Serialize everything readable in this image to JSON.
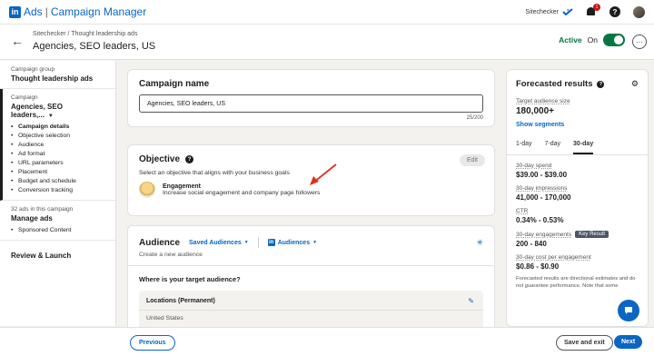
{
  "topbar": {
    "brand_ads": "Ads",
    "brand_sep": "|",
    "brand_name": "Campaign Manager",
    "account_name": "Sitechecker",
    "notifications": "1"
  },
  "header": {
    "breadcrumb": "Sitechecker / Thought leadership ads",
    "title": "Agencies, SEO leaders, US",
    "status_active": "Active",
    "status_on": "On"
  },
  "sidebar": {
    "group_label": "Campaign group",
    "group_value": "Thought leadership ads",
    "campaign_label": "Campaign",
    "campaign_value": "Agencies, SEO leaders,...",
    "steps": [
      "Campaign details",
      "Objective selection",
      "Audience",
      "Ad format",
      "URL parameters",
      "Placement",
      "Budget and schedule",
      "Conversion tracking"
    ],
    "ads_label": "32 ads in this campaign",
    "ads_value": "Manage ads",
    "ads_items": [
      "Sponsored Content"
    ],
    "review": "Review & Launch"
  },
  "campaign_name": {
    "title": "Campaign name",
    "value": "Agencies, SEO leaders, US",
    "counter": "25/200"
  },
  "objective": {
    "title": "Objective",
    "edit": "Edit",
    "subtitle": "Select an objective that aligns with your business goals",
    "selected_name": "Engagement",
    "selected_desc": "Increase social engagement and company page followers"
  },
  "audience": {
    "title": "Audience",
    "saved": "Saved Audiences",
    "audiences": "Audiences",
    "subtitle": "Create a new audience",
    "question": "Where is your target audience?",
    "locations_label": "Locations (Permanent)",
    "location_value": "United States"
  },
  "forecast": {
    "title": "Forecasted results",
    "size_label": "Target audience size",
    "size_value": "180,000+",
    "show_segments": "Show segments",
    "tabs": [
      "1-day",
      "7-day",
      "30-day"
    ],
    "spend_label": "30-day spend",
    "spend_value": "$39.00 - $39.00",
    "impressions_label": "30-day impressions",
    "impressions_value": "41,000 - 170,000",
    "ctr_label": "CTR",
    "ctr_value": "0.34% - 0.53%",
    "engagements_label": "30-day engagements",
    "key_result": "Key Result",
    "engagements_value": "200 - 840",
    "cost_label": "30-day cost per engagement",
    "cost_value": "$0.86 - $0.90",
    "footnote": "Forecasted results are directional estimates and do not guarantee performance. Note that some"
  },
  "footer": {
    "previous": "Previous",
    "save_exit": "Save and exit",
    "next": "Next"
  },
  "colors": {
    "brand": "#0a66c2",
    "active": "#057642",
    "arrow": "#e0301e"
  }
}
